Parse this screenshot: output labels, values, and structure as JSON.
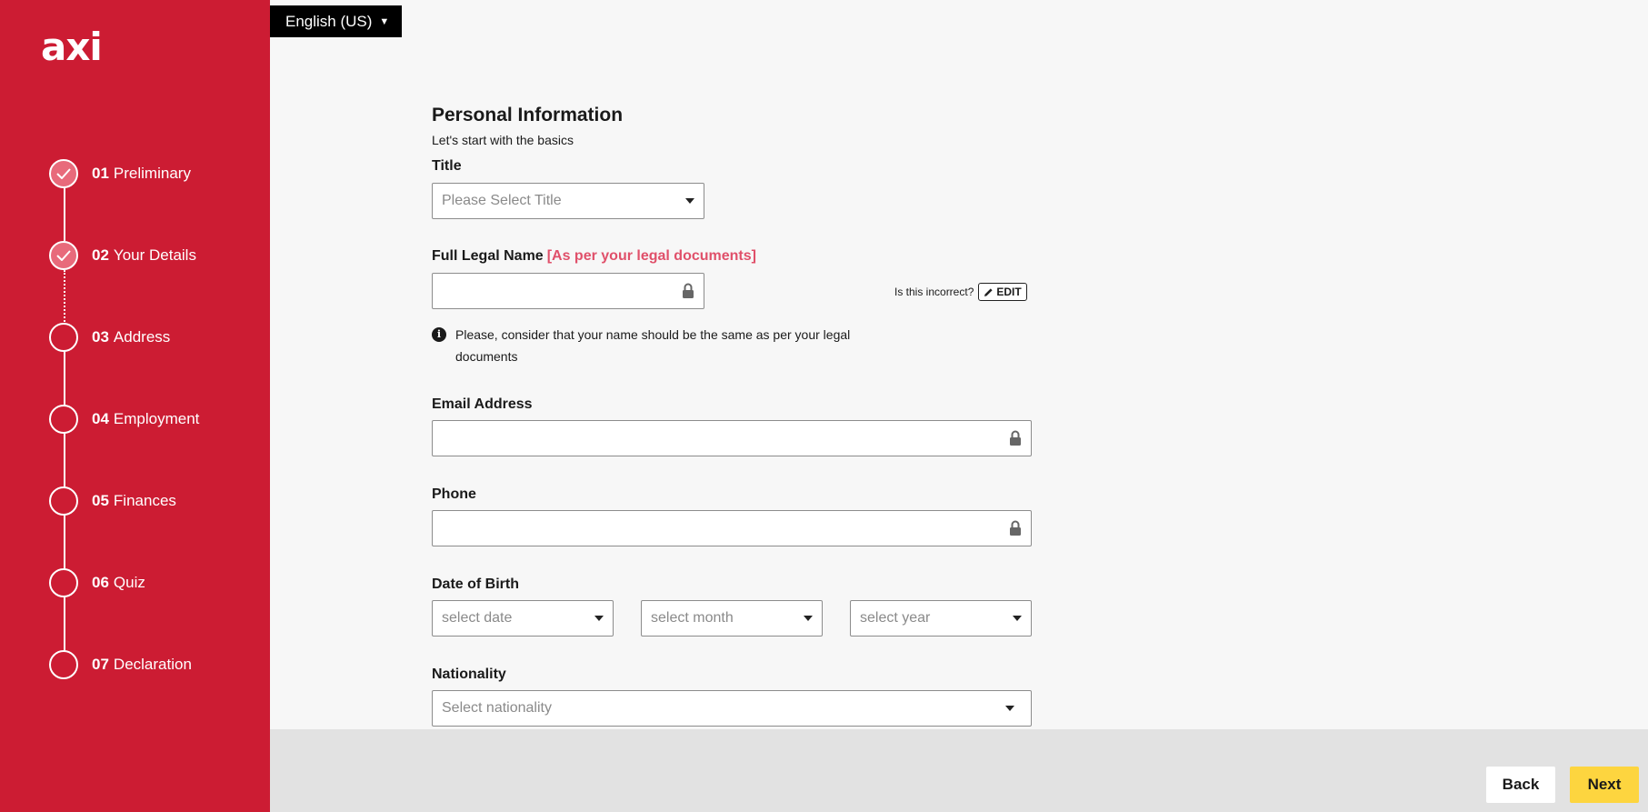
{
  "brand": {
    "logo_text": "axi",
    "sidebar_color": "#cc1c33"
  },
  "language": {
    "label": "English (US)"
  },
  "steps": [
    {
      "num": "01",
      "label": "Preliminary",
      "status": "complete"
    },
    {
      "num": "02",
      "label": "Your Details",
      "status": "complete"
    },
    {
      "num": "03",
      "label": "Address",
      "status": "pending"
    },
    {
      "num": "04",
      "label": "Employment",
      "status": "pending"
    },
    {
      "num": "05",
      "label": "Finances",
      "status": "pending"
    },
    {
      "num": "06",
      "label": "Quiz",
      "status": "pending"
    },
    {
      "num": "07",
      "label": "Declaration",
      "status": "pending"
    }
  ],
  "form": {
    "title": "Personal Information",
    "subtitle": "Let's start with the basics",
    "title_field": {
      "label": "Title",
      "placeholder": "Please Select Title"
    },
    "full_name": {
      "label": "Full Legal Name",
      "hint": "[As per your legal documents]",
      "value": "",
      "incorrect_text": "Is this incorrect?",
      "edit_label": "EDIT",
      "info": "Please, consider that your name should be the same as per your legal documents"
    },
    "email": {
      "label": "Email Address",
      "value": ""
    },
    "phone": {
      "label": "Phone",
      "value": ""
    },
    "dob": {
      "label": "Date of Birth",
      "date_placeholder": "select date",
      "month_placeholder": "select month",
      "year_placeholder": "select year"
    },
    "nationality": {
      "label": "Nationality",
      "placeholder": "Select nationality"
    }
  },
  "footer": {
    "back_label": "Back",
    "next_label": "Next",
    "next_color": "#fdd53f"
  }
}
